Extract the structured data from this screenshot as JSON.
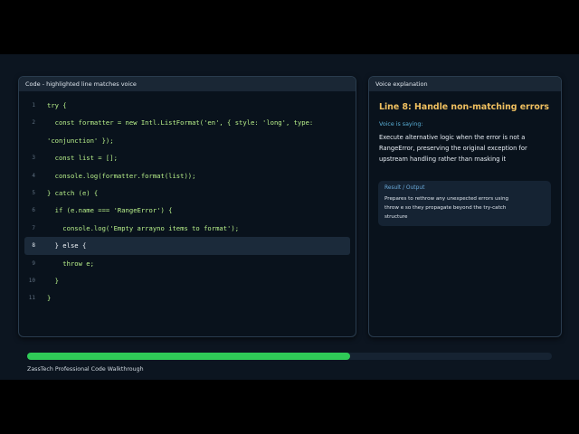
{
  "code_panel": {
    "title": "Code - highlighted line matches voice",
    "highlighted_line": 8,
    "lines": [
      {
        "n": "1",
        "code": "try {"
      },
      {
        "n": "2",
        "code": "  const formatter = new Intl.ListFormat('en', { style: 'long', type:"
      },
      {
        "n": "",
        "code": "'conjunction' });"
      },
      {
        "n": "3",
        "code": "  const list = [];"
      },
      {
        "n": "4",
        "code": "  console.log(formatter.format(list));"
      },
      {
        "n": "5",
        "code": "} catch (e) {"
      },
      {
        "n": "6",
        "code": "  if (e.name === 'RangeError') {"
      },
      {
        "n": "7",
        "code": "    console.log('Empty arrayno items to format');"
      },
      {
        "n": "8",
        "code": "  } else {"
      },
      {
        "n": "9",
        "code": "    throw e;"
      },
      {
        "n": "10",
        "code": "  }"
      },
      {
        "n": "11",
        "code": "}"
      }
    ]
  },
  "voice_panel": {
    "title": "Voice explanation",
    "heading": "Line 8: Handle non-matching errors",
    "saying_label": "Voice is saying:",
    "saying_text": "Execute alternative logic when the error is not a RangeError, preserving the original exception for upstream handling rather than masking it",
    "result_label": "Result / Output",
    "result_text": "Prepares to rethrow any unexpected errors using throw e so they propagate beyond the try-catch structure"
  },
  "progress": {
    "fraction": 0.615,
    "color": "#2fca57"
  },
  "footer": {
    "text": "ZassTech Professional Code Walkthrough"
  }
}
